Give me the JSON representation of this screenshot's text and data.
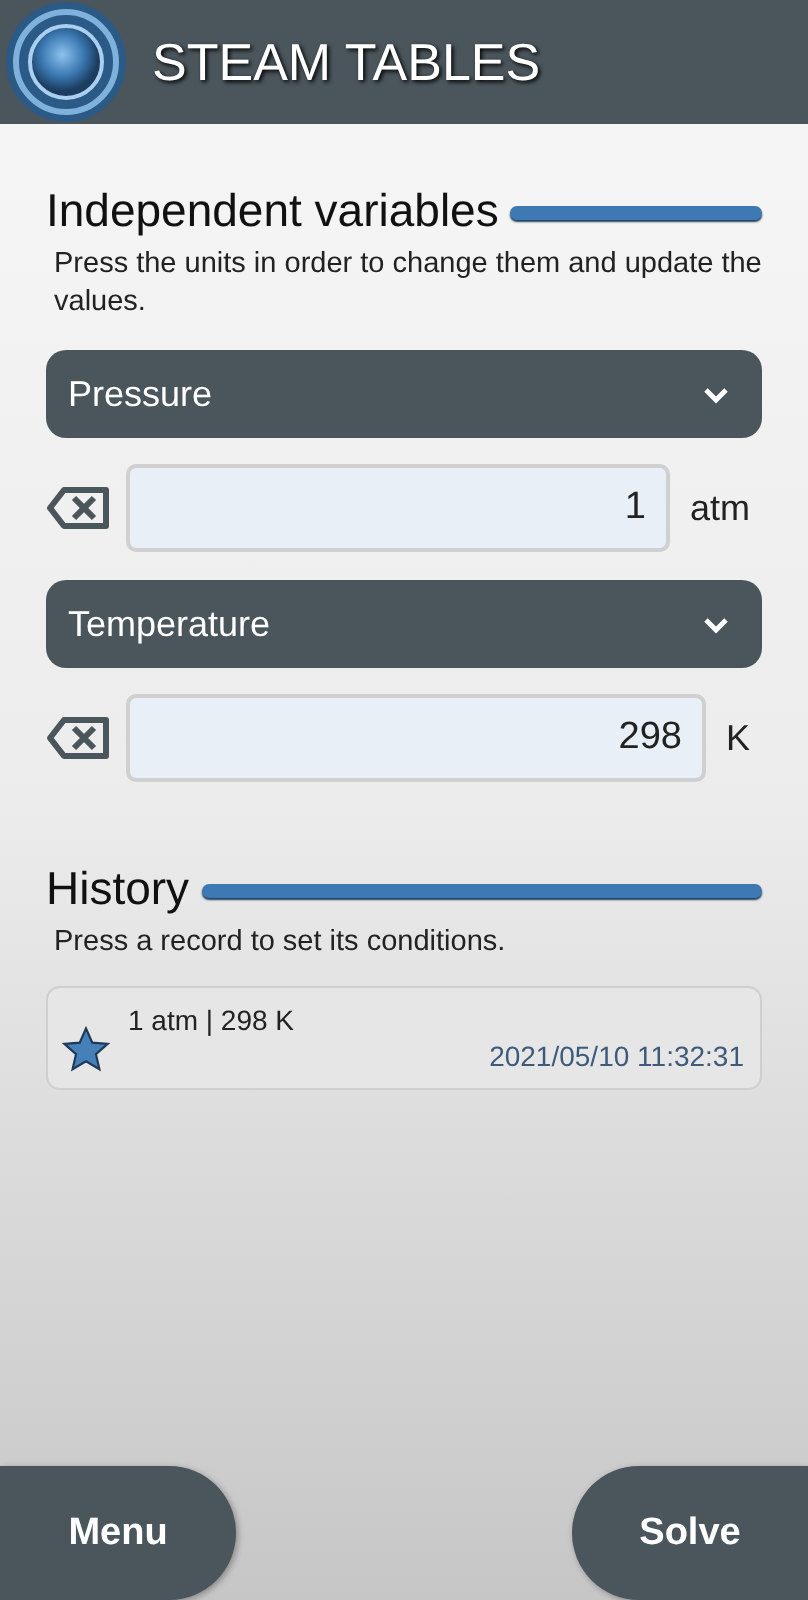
{
  "header": {
    "title": "STEAM TABLES"
  },
  "variables_section": {
    "title": "Independent variables",
    "hint": "Press the units in order to change them and update the values.",
    "variables": [
      {
        "selector": "Pressure",
        "value": "1",
        "unit": "atm"
      },
      {
        "selector": "Temperature",
        "value": "298",
        "unit": "K"
      }
    ]
  },
  "history_section": {
    "title": "History",
    "hint": "Press a record to set its conditions.",
    "records": [
      {
        "conditions": "1 atm | 298 K",
        "timestamp": "2021/05/10 11:32:31"
      }
    ]
  },
  "bottom_bar": {
    "left_button": "Menu",
    "right_button": "Solve"
  }
}
